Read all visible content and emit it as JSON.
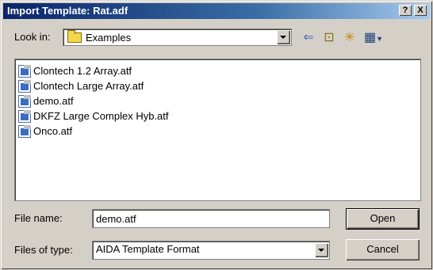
{
  "window": {
    "title": "Import Template: Rat.adf",
    "help_label": "?",
    "close_label": "X"
  },
  "look_in": {
    "label": "Look in:",
    "value": "Examples",
    "icon": "folder-icon"
  },
  "toolbar": {
    "back_icon": "back-arrow-icon",
    "back_glyph": "⇐",
    "up_icon": "up-folder-icon",
    "up_glyph": "⊡",
    "new_folder_icon": "new-folder-icon",
    "new_folder_glyph": "✳",
    "view_icon": "view-menu-icon",
    "view_glyph": "▦"
  },
  "files": [
    {
      "name": "Clontech 1.2 Array.atf"
    },
    {
      "name": "Clontech Large Array.atf"
    },
    {
      "name": "demo.atf"
    },
    {
      "name": "DKFZ Large Complex Hyb.atf"
    },
    {
      "name": "Onco.atf"
    }
  ],
  "file_name": {
    "label": "File name:",
    "value": "demo.atf"
  },
  "file_type": {
    "label": "Files of type:",
    "value": "AIDA Template Format"
  },
  "buttons": {
    "open": "Open",
    "cancel": "Cancel"
  },
  "colors": {
    "titlebar_start": "#0a246a",
    "titlebar_end": "#a6caf0",
    "face": "#d4d0c8"
  }
}
